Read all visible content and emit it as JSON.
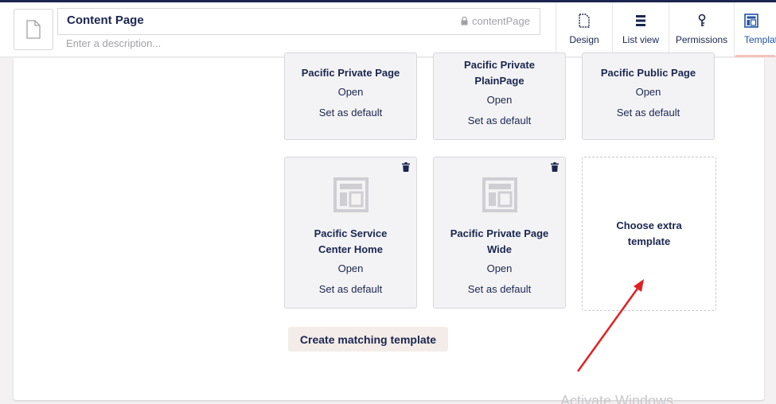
{
  "header": {
    "name": "Content Page",
    "alias": "contentPage",
    "description_placeholder": "Enter a description...",
    "apps": [
      {
        "label": "Design",
        "icon": "document-icon"
      },
      {
        "label": "List view",
        "icon": "list-icon"
      },
      {
        "label": "Permissions",
        "icon": "key-icon"
      },
      {
        "label": "Templat",
        "icon": "template-icon",
        "active": true
      }
    ]
  },
  "templates": [
    {
      "name": "Pacific Private Page",
      "open": "Open",
      "set_default": "Set as default"
    },
    {
      "name": "Pacific Private PlainPage",
      "open": "Open",
      "set_default": "Set as default"
    },
    {
      "name": "Pacific Public Page",
      "open": "Open",
      "set_default": "Set as default"
    },
    {
      "name": "Pacific Service Center Home",
      "open": "Open",
      "set_default": "Set as default"
    },
    {
      "name": "Pacific Private Page Wide",
      "open": "Open",
      "set_default": "Set as default"
    }
  ],
  "choose_extra": "Choose extra template",
  "create_matching": "Create matching template",
  "watermark": "Activate Windows",
  "colors": {
    "primary": "#1b264f",
    "accent": "#f5c1bc",
    "annotation": "#e02020"
  }
}
